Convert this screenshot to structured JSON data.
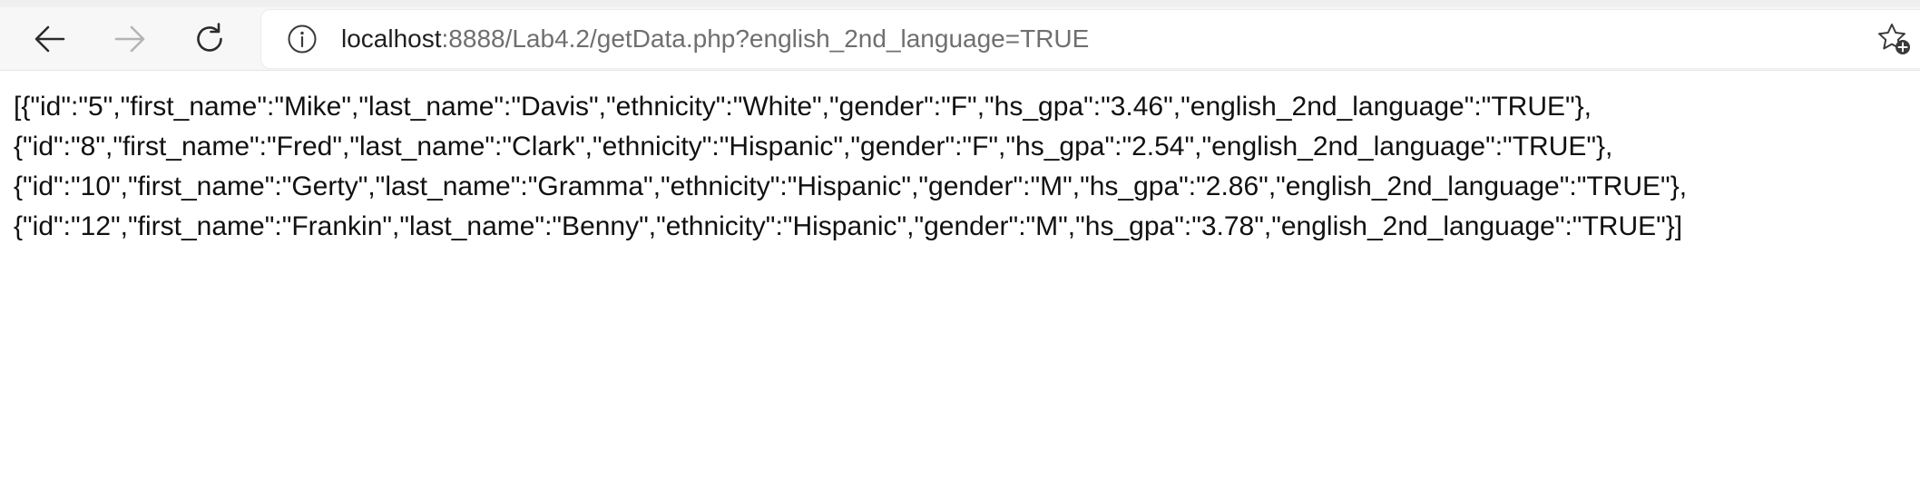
{
  "browser": {
    "url_host": "localhost",
    "url_rest": ":8888/Lab4.2/getData.php?english_2nd_language=TRUE",
    "icons": {
      "back": "arrow-left-icon",
      "forward": "arrow-right-icon",
      "reload": "reload-icon",
      "site_info": "info-icon",
      "favorite": "star-add-icon"
    }
  },
  "page": {
    "lines": [
      "[{\"id\":\"5\",\"first_name\":\"Mike\",\"last_name\":\"Davis\",\"ethnicity\":\"White\",\"gender\":\"F\",\"hs_gpa\":\"3.46\",\"english_2nd_language\":\"TRUE\"},",
      "{\"id\":\"8\",\"first_name\":\"Fred\",\"last_name\":\"Clark\",\"ethnicity\":\"Hispanic\",\"gender\":\"F\",\"hs_gpa\":\"2.54\",\"english_2nd_language\":\"TRUE\"},",
      "{\"id\":\"10\",\"first_name\":\"Gerty\",\"last_name\":\"Gramma\",\"ethnicity\":\"Hispanic\",\"gender\":\"M\",\"hs_gpa\":\"2.86\",\"english_2nd_language\":\"TRUE\"},",
      "{\"id\":\"12\",\"first_name\":\"Frankin\",\"last_name\":\"Benny\",\"ethnicity\":\"Hispanic\",\"gender\":\"M\",\"hs_gpa\":\"3.78\",\"english_2nd_language\":\"TRUE\"}]"
    ]
  }
}
